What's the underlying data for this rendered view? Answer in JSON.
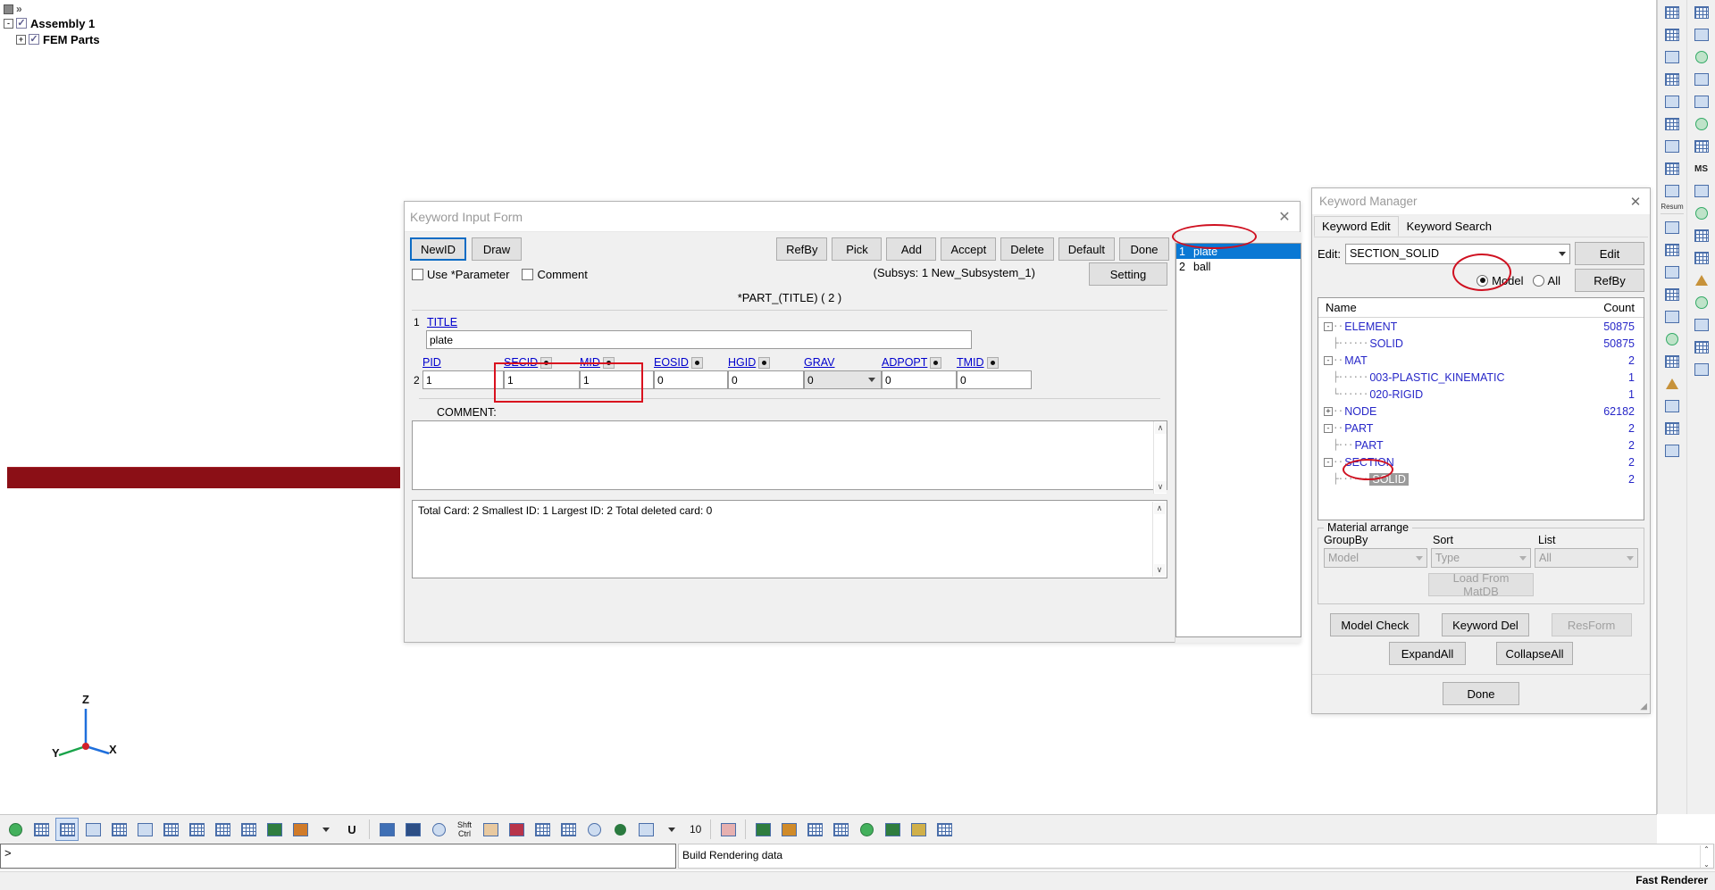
{
  "app": {
    "assembly_tree": {
      "root_label": "Assembly 1",
      "child_label": "FEM Parts",
      "expander_root": "-",
      "expander_child": "+",
      "check_glyph": "✓",
      "chevron": "»"
    },
    "axis": {
      "z": "Z",
      "y": "Y",
      "x": "X"
    },
    "command_prompt": ">",
    "command_value": "",
    "message": "Build Rendering data",
    "renderer": "Fast Renderer",
    "bottom_toolbar": {
      "shift_label": "Shft",
      "ctrl_label": "Ctrl",
      "count_value": "10",
      "u_label": "U"
    },
    "right_toolbar": {
      "resum_label": "Resum",
      "ms_label": "MS"
    }
  },
  "keyword_input_form": {
    "title": "Keyword Input Form",
    "close_icon": "✕",
    "buttons_left": [
      {
        "label": "NewID",
        "focus": true
      },
      {
        "label": "Draw",
        "focus": false
      }
    ],
    "buttons_right": [
      {
        "label": "RefBy",
        "disabled": false
      },
      {
        "label": "Pick",
        "disabled": false
      },
      {
        "label": "Add",
        "disabled": false
      },
      {
        "label": "Accept",
        "disabled": false
      },
      {
        "label": "Delete",
        "disabled": false
      },
      {
        "label": "Default",
        "disabled": false
      },
      {
        "label": "Done",
        "disabled": false
      }
    ],
    "checkboxes": [
      {
        "label": "Use *Parameter",
        "checked": false
      },
      {
        "label": "Comment",
        "checked": false
      }
    ],
    "subsystem_text": "(Subsys: 1 New_Subsystem_1)",
    "setting_label": "Setting",
    "card_title": "*PART_(TITLE)    ( 2 )",
    "row1": {
      "number": "1",
      "label": "TITLE",
      "value": "plate"
    },
    "row2": {
      "number": "2",
      "fields": [
        {
          "label": "PID",
          "value": "1",
          "has_dot": false,
          "type": "text"
        },
        {
          "label": "SECID",
          "value": "1",
          "has_dot": true,
          "type": "text"
        },
        {
          "label": "MID",
          "value": "1",
          "has_dot": true,
          "type": "text"
        },
        {
          "label": "EOSID",
          "value": "0",
          "has_dot": true,
          "type": "text"
        },
        {
          "label": "HGID",
          "value": "0",
          "has_dot": true,
          "type": "text"
        },
        {
          "label": "GRAV",
          "value": "0",
          "has_dot": false,
          "type": "select"
        },
        {
          "label": "ADPOPT",
          "value": "0",
          "has_dot": true,
          "type": "text"
        },
        {
          "label": "TMID",
          "value": "0",
          "has_dot": true,
          "type": "text"
        }
      ]
    },
    "comment_label": "COMMENT:",
    "comment_value": "",
    "total_line": "Total Card: 2    Smallest ID: 1   Largest ID: 2   Total deleted card:  0",
    "part_list": [
      {
        "index": "1",
        "name": "plate",
        "selected": true
      },
      {
        "index": "2",
        "name": "ball",
        "selected": false
      }
    ],
    "scroll_up": "∧",
    "scroll_down": "∨"
  },
  "keyword_manager": {
    "title": "Keyword Manager",
    "close_icon": "✕",
    "tabs": [
      {
        "label": "Keyword Edit",
        "active": true
      },
      {
        "label": "Keyword Search",
        "active": false
      }
    ],
    "edit_label": "Edit:",
    "edit_value": "SECTION_SOLID",
    "edit_button": "Edit",
    "refby_button": "RefBy",
    "scope_options": [
      {
        "label": "Model",
        "selected": true
      },
      {
        "label": "All",
        "selected": false
      }
    ],
    "tree_headers": {
      "name": "Name",
      "count": "Count"
    },
    "tree": [
      {
        "level": 0,
        "expander": "-",
        "label": "ELEMENT",
        "count": "50875",
        "highlight": false
      },
      {
        "level": 1,
        "expander": "",
        "label": "SOLID",
        "count": "50875",
        "highlight": false
      },
      {
        "level": 0,
        "expander": "-",
        "label": "MAT",
        "count": "2",
        "highlight": false
      },
      {
        "level": 1,
        "expander": "",
        "label": "003-PLASTIC_KINEMATIC",
        "count": "1",
        "highlight": false
      },
      {
        "level": 1,
        "expander": "",
        "label": "020-RIGID",
        "count": "1",
        "highlight": false
      },
      {
        "level": 0,
        "expander": "+",
        "label": "NODE",
        "count": "62182",
        "highlight": false
      },
      {
        "level": 0,
        "expander": "-",
        "label": "PART",
        "count": "2",
        "highlight": false
      },
      {
        "level": 1,
        "expander": "",
        "label": "PART",
        "count": "2",
        "highlight": false
      },
      {
        "level": 0,
        "expander": "-",
        "label": "SECTION",
        "count": "2",
        "highlight": false
      },
      {
        "level": 1,
        "expander": "",
        "label": "SOLID",
        "count": "2",
        "highlight": true
      }
    ],
    "material_arrange": {
      "legend": "Material arrange",
      "groupby_label": "GroupBy",
      "groupby_value": "Model",
      "sort_label": "Sort",
      "sort_value": "Type",
      "list_label": "List",
      "list_value": "All",
      "load_button": "Load From MatDB"
    },
    "buttons": {
      "model_check": "Model Check",
      "keyword_del": "Keyword Del",
      "res_form": "ResForm",
      "expand_all": "ExpandAll",
      "collapse_all": "CollapseAll",
      "done": "Done"
    }
  },
  "annotations": {
    "secid_mid_rect_color": "#d9121f",
    "ellipse_color": "#cf1020",
    "ellipses": [
      {
        "name": "plate-item-ellipse"
      },
      {
        "name": "model-radio-ellipse"
      },
      {
        "name": "part-tree-ellipse"
      }
    ]
  },
  "colors": {
    "accent_blue": "#0a78d4",
    "window_bg": "#f0f0f0",
    "model_red": "#8b0f16",
    "link_blue": "#0000cd",
    "tree_blue": "#2727c8"
  }
}
